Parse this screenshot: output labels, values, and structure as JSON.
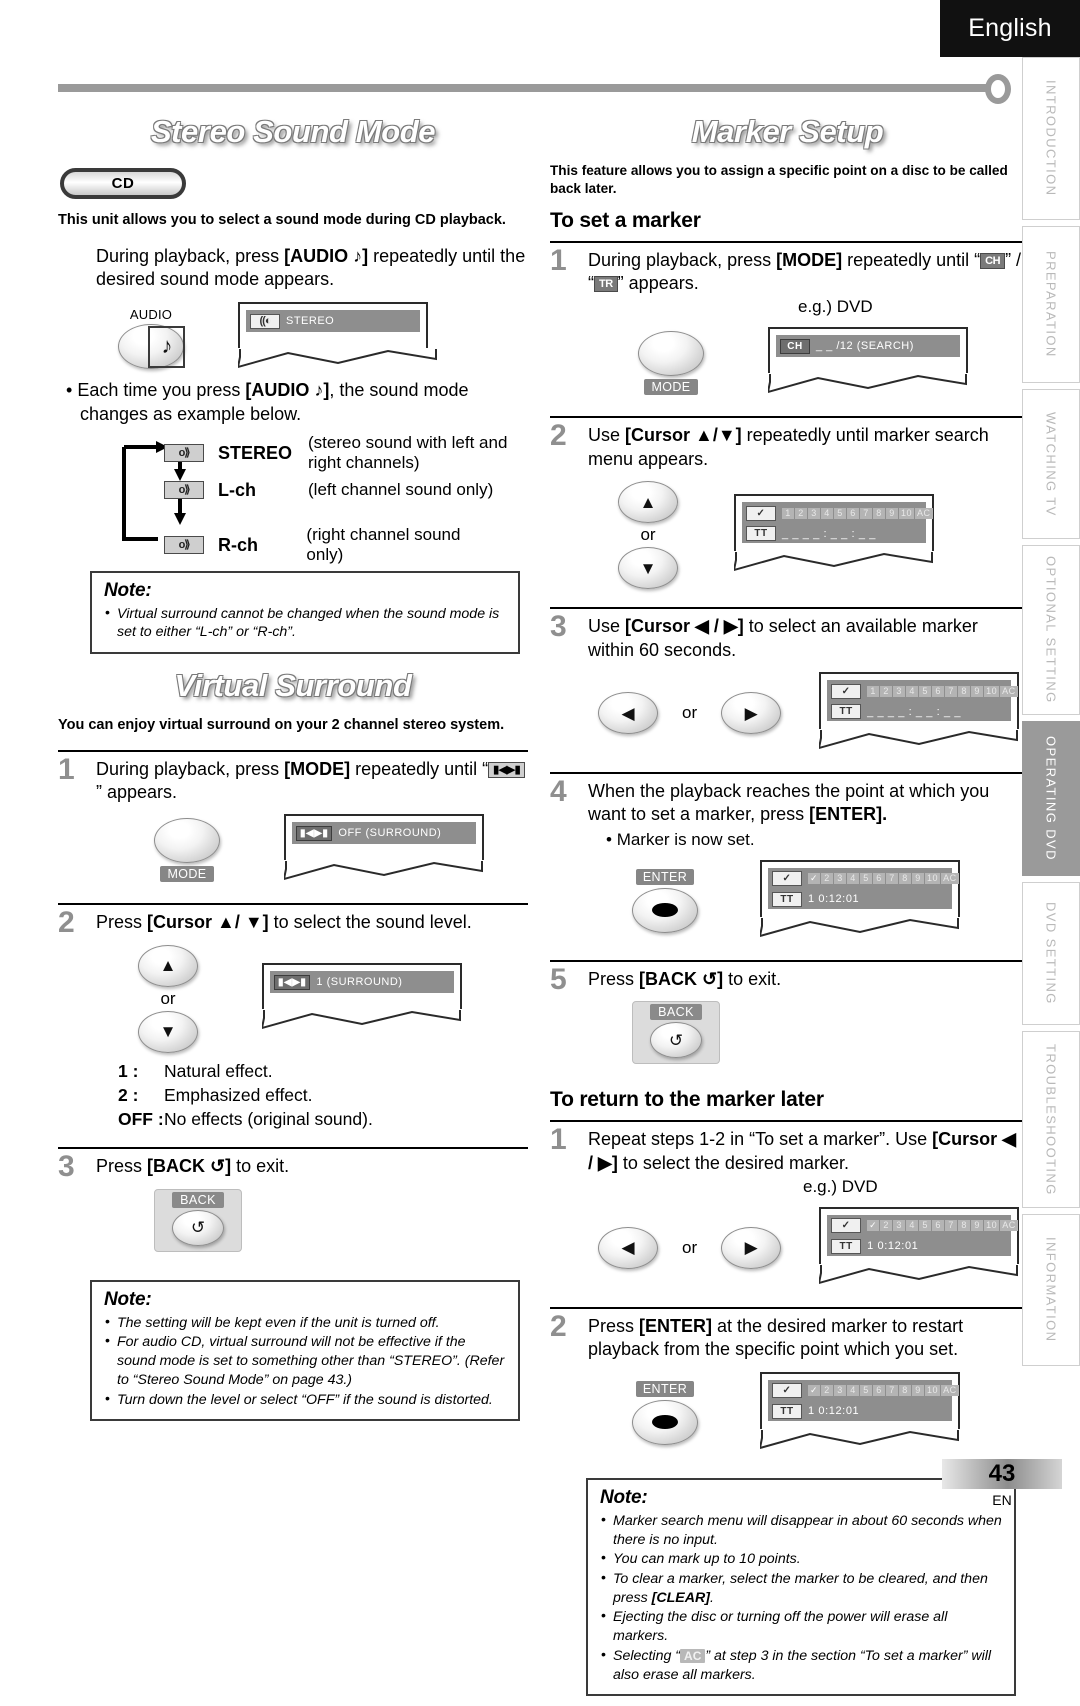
{
  "header": {
    "language": "English"
  },
  "footer": {
    "page_number": "43",
    "page_code": "EN"
  },
  "sidebar": {
    "tabs": [
      {
        "label": "INTRODUCTION",
        "active": false
      },
      {
        "label": "PREPARATION",
        "active": false
      },
      {
        "label": "WATCHING TV",
        "active": false
      },
      {
        "label": "OPTIONAL SETTING",
        "active": false
      },
      {
        "label": "OPERATING DVD",
        "active": true
      },
      {
        "label": "DVD SETTING",
        "active": false
      },
      {
        "label": "TROUBLESHOOTING",
        "active": false
      },
      {
        "label": "INFORMATION",
        "active": false
      }
    ]
  },
  "left": {
    "stereo": {
      "title": "Stereo Sound Mode",
      "badge": "CD",
      "intro": "This unit allows you to select a sound mode during CD playback.",
      "instruction_a": "During playback, press ",
      "instruction_b": "[AUDIO ♪]",
      "instruction_c": " repeatedly until the desired sound mode appears.",
      "key_label": "AUDIO",
      "key_glyph": "♪",
      "osd_icon": "((◐",
      "osd_text": "STEREO",
      "bullet_a": "Each time you press ",
      "bullet_b": "[AUDIO ♪]",
      "bullet_c": ", the sound mode changes as example below.",
      "modes": [
        {
          "icon": "o⟫",
          "name": "STEREO",
          "desc": "(stereo sound with left and right channels)"
        },
        {
          "icon": "o⟫",
          "name": "L-ch",
          "desc": "(left channel sound only)"
        },
        {
          "icon": "o⟫",
          "name": "R-ch",
          "desc": "(right channel sound only)"
        }
      ],
      "note_title": "Note:",
      "notes": [
        "Virtual surround cannot be changed when the sound mode is set to either “L-ch” or “R-ch”."
      ]
    },
    "surround": {
      "title": "Virtual Surround",
      "intro": "You can enjoy virtual surround on your 2 channel stereo system.",
      "steps": [
        {
          "num": "1",
          "text_a": "During playback, press ",
          "text_b": "[MODE]",
          "text_c": " repeatedly until “",
          "icon": "▮◀▶▮",
          "text_d": "” appears.",
          "key_cap": "MODE",
          "osd_icon": "▮◀▶▮",
          "osd_text": "OFF (SURROUND)"
        },
        {
          "num": "2",
          "text_a": "Press ",
          "text_b": "[Cursor ▲/ ▼]",
          "text_c": " to select the sound level.",
          "or_label": "or",
          "osd_icon": "▮◀▶▮",
          "osd_text": "1 (SURROUND)",
          "levels": [
            {
              "key": "1 :",
              "desc": "Natural effect."
            },
            {
              "key": "2 :",
              "desc": "Emphasized effect."
            },
            {
              "key": "OFF :",
              "desc": "No effects (original sound)."
            }
          ]
        },
        {
          "num": "3",
          "text_a": "Press ",
          "text_b": "[BACK ↺]",
          "text_c": " to exit.",
          "key_cap": "BACK",
          "key_glyph": "↺"
        }
      ],
      "note_title": "Note:",
      "notes": [
        "The setting will be kept even if the unit is turned off.",
        "For audio CD, virtual surround will not be effective if the sound mode is set to something other than “STEREO”. (Refer to “Stereo Sound Mode” on page 43.)",
        "Turn down the level or select “OFF” if the sound is distorted."
      ]
    }
  },
  "right": {
    "marker": {
      "title": "Marker Setup",
      "intro": "This feature allows you to assign a specific point on a disc to be called back later.",
      "subhead_set": "To set a marker",
      "subhead_return": "To return to the marker later",
      "eg_label": "e.g.) DVD",
      "or_label": "or",
      "steps_set": [
        {
          "num": "1",
          "text_a": "During playback, press ",
          "text_b": "[MODE]",
          "text_c": " repeatedly until “",
          "icon1": "CH",
          "text_d": "” / “",
          "icon2": "TR",
          "text_e": "” appears.",
          "key_cap": "MODE",
          "osd_icon": "CH",
          "osd_text": "_ _ /12  (SEARCH)"
        },
        {
          "num": "2",
          "text_a": "Use ",
          "text_b": "[Cursor ▲/▼]",
          "text_c": " repeatedly until marker search menu appears.",
          "osd_icon1": "✓",
          "osd_icon2": "TT",
          "osd_markers": [
            "1",
            "2",
            "3",
            "4",
            "5",
            "6",
            "7",
            "8",
            "9",
            "10",
            "AC"
          ],
          "osd_time": "_ _  _ _ : _ _ : _ _"
        },
        {
          "num": "3",
          "text_a": "Use ",
          "text_b": "[Cursor ◀ / ▶]",
          "text_c": " to select an available marker within 60 seconds.",
          "osd_icon1": "✓",
          "osd_icon2": "TT",
          "osd_markers": [
            "1",
            "2",
            "3",
            "4",
            "5",
            "6",
            "7",
            "8",
            "9",
            "10",
            "AC"
          ],
          "osd_time": "_ _  _ _ : _ _ : _ _"
        },
        {
          "num": "4",
          "text_a": "When the playback reaches the point at which you want to set a marker, press ",
          "text_b": "[ENTER].",
          "bullet": "Marker is now set.",
          "key_cap": "ENTER",
          "osd_icon1": "✓",
          "osd_icon2": "TT",
          "osd_markers": [
            "✓",
            "2",
            "3",
            "4",
            "5",
            "6",
            "7",
            "8",
            "9",
            "10",
            "AC"
          ],
          "osd_time": "1  0:12:01"
        },
        {
          "num": "5",
          "text_a": "Press ",
          "text_b": "[BACK ↺]",
          "text_c": " to exit.",
          "key_cap": "BACK",
          "key_glyph": "↺"
        }
      ],
      "steps_return": [
        {
          "num": "1",
          "text_a": "Repeat steps 1-2 in “To set a marker”. Use ",
          "text_b": "[Cursor ◀ / ▶]",
          "text_c": " to select the desired marker.",
          "osd_icon1": "✓",
          "osd_icon2": "TT",
          "osd_markers": [
            "✓",
            "2",
            "3",
            "4",
            "5",
            "6",
            "7",
            "8",
            "9",
            "10",
            "AC"
          ],
          "osd_time": "1  0:12:01"
        },
        {
          "num": "2",
          "text_a": "Press ",
          "text_b": "[ENTER]",
          "text_c": " at the desired marker to restart playback from the specific point which you set.",
          "key_cap": "ENTER",
          "osd_icon1": "✓",
          "osd_icon2": "TT",
          "osd_markers": [
            "✓",
            "2",
            "3",
            "4",
            "5",
            "6",
            "7",
            "8",
            "9",
            "10",
            "AC"
          ],
          "osd_time": "1  0:12:01"
        }
      ],
      "note_title": "Note:",
      "notes": [
        {
          "text": "Marker search menu will disappear in about 60 seconds when there is no input."
        },
        {
          "text": "You can mark up to 10 points."
        },
        {
          "text_a": "To clear a marker, select the marker to be cleared, and then press ",
          "bold": "[CLEAR]",
          "text_b": "."
        },
        {
          "text": "Ejecting the disc or turning off the power will erase all markers."
        },
        {
          "text_a": "Selecting “",
          "chip": "AC",
          "text_b": "” at step 3 in the section “To set a marker” will also erase all markers."
        }
      ]
    }
  }
}
